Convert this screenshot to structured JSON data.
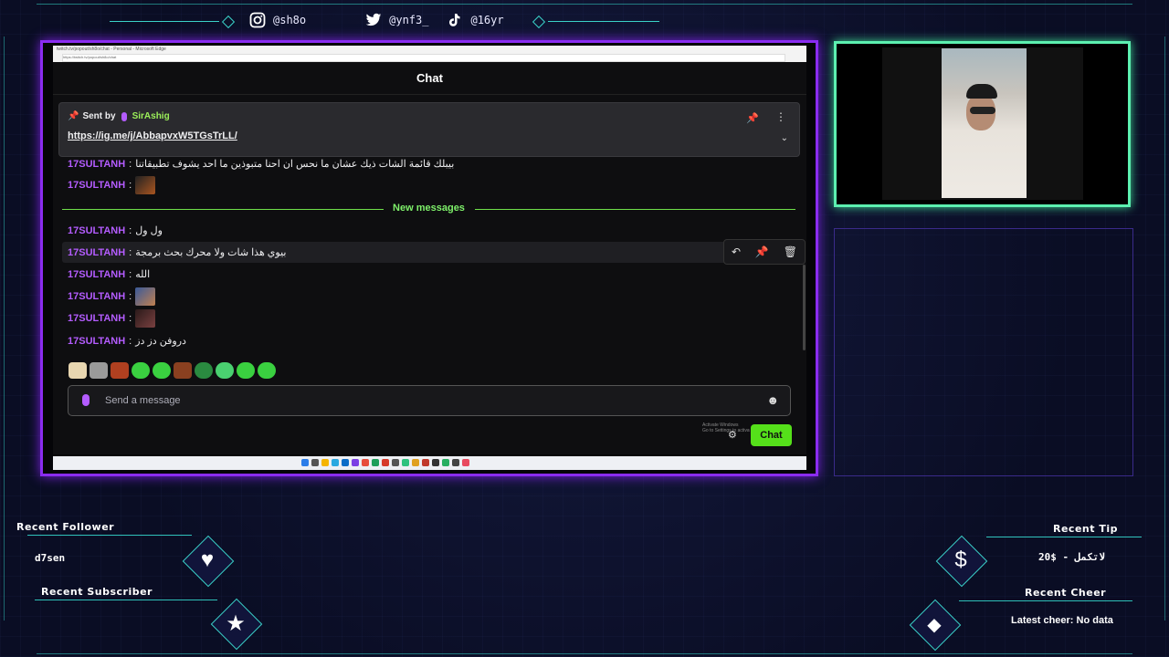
{
  "socials": [
    {
      "icon": "instagram-icon",
      "handle": "@sh8o"
    },
    {
      "icon": "twitter-icon",
      "handle": "@ynf3_"
    },
    {
      "icon": "tiktok-icon",
      "handle": "@16yr"
    }
  ],
  "browser": {
    "tab_title": "twitch.tv/popout/sh8o/chat - Personal - Microsoft Edge",
    "url": "https://twitch.tv/popout/sh8o/chat"
  },
  "chat": {
    "title": "Chat",
    "pinned": {
      "prefix": "Sent by",
      "user": "SirAshig",
      "link": "https://ig.me/j/AbbapvxW5TGsTrLL/"
    },
    "new_messages_label": "New messages",
    "messages_before": [
      {
        "user": "17SULTANH",
        "text": "بيبلك قائمة الشات ذيك عشان ما نحس ان احنا متبوذين ما احد يشوف تطبيقاتنا"
      },
      {
        "user": "17SULTANH",
        "text": ""
      }
    ],
    "messages_after": [
      {
        "user": "17SULTANH",
        "text": "ول ول"
      },
      {
        "user": "17SULTANH",
        "text": "بيوي هذا شات ولا محرك بحث برمجة"
      },
      {
        "user": "17SULTANH",
        "text": "الله"
      },
      {
        "user": "17SULTANH",
        "text": ""
      },
      {
        "user": "17SULTANH",
        "text": ""
      },
      {
        "user": "17SULTANH",
        "text": "دروفن دز دز"
      }
    ],
    "input_placeholder": "Send a message",
    "send_button": "Chat",
    "activate_windows": "Activate Windows",
    "activate_sub": "Go to Settings to activate Windows."
  },
  "widgets": {
    "recent_follower_label": "Recent Follower",
    "recent_follower_value": "d7sen",
    "recent_subscriber_label": "Recent Subscriber",
    "recent_subscriber_value": "",
    "recent_tip_label": "Recent Tip",
    "recent_tip_value": "20$ - لاتكمل",
    "recent_cheer_label": "Recent Cheer",
    "recent_cheer_value": "Latest cheer: No data"
  },
  "colors": {
    "frame_purple": "#8a2cf0",
    "frame_green": "#5cf0b0",
    "username_purple": "#b45cff",
    "accent_green": "#55e01a"
  }
}
